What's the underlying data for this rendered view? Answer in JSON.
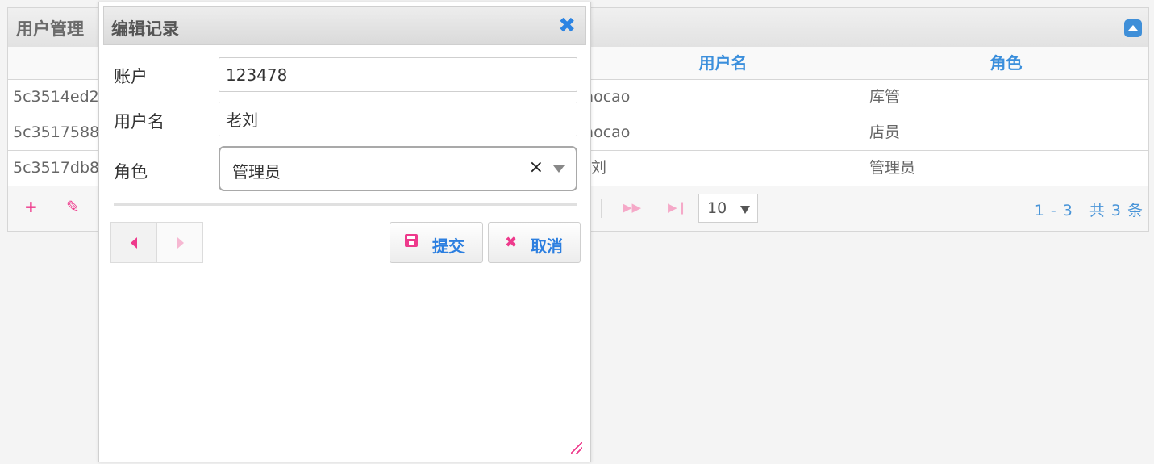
{
  "grid": {
    "title": "用户管理",
    "columns": [
      "",
      "用户名",
      "角色"
    ],
    "rows": [
      {
        "id": "5c3514ed2",
        "username": "caocao",
        "role": "库管"
      },
      {
        "id": "5c3517588",
        "username": "caocao",
        "role": "店员"
      },
      {
        "id": "5c3517db8",
        "username": "老刘",
        "role": "管理员"
      }
    ],
    "pager": {
      "add_icon": "plus-icon",
      "edit_icon": "pencil-icon",
      "next_icon": "next-page-icon",
      "last_icon": "last-page-icon",
      "page_size": "10",
      "info": "1 - 3　共 3 条"
    }
  },
  "dialog": {
    "title": "编辑记录",
    "close_icon": "close-icon",
    "fields": {
      "account_label": "账户",
      "account_value": "123478",
      "username_label": "用户名",
      "username_value": "老刘",
      "role_label": "角色",
      "role_value": "管理员"
    },
    "buttons": {
      "submit_label": "提交",
      "cancel_label": "取消"
    }
  },
  "colors": {
    "accent_blue": "#3b8fdc",
    "accent_pink": "#ee3a8c"
  }
}
